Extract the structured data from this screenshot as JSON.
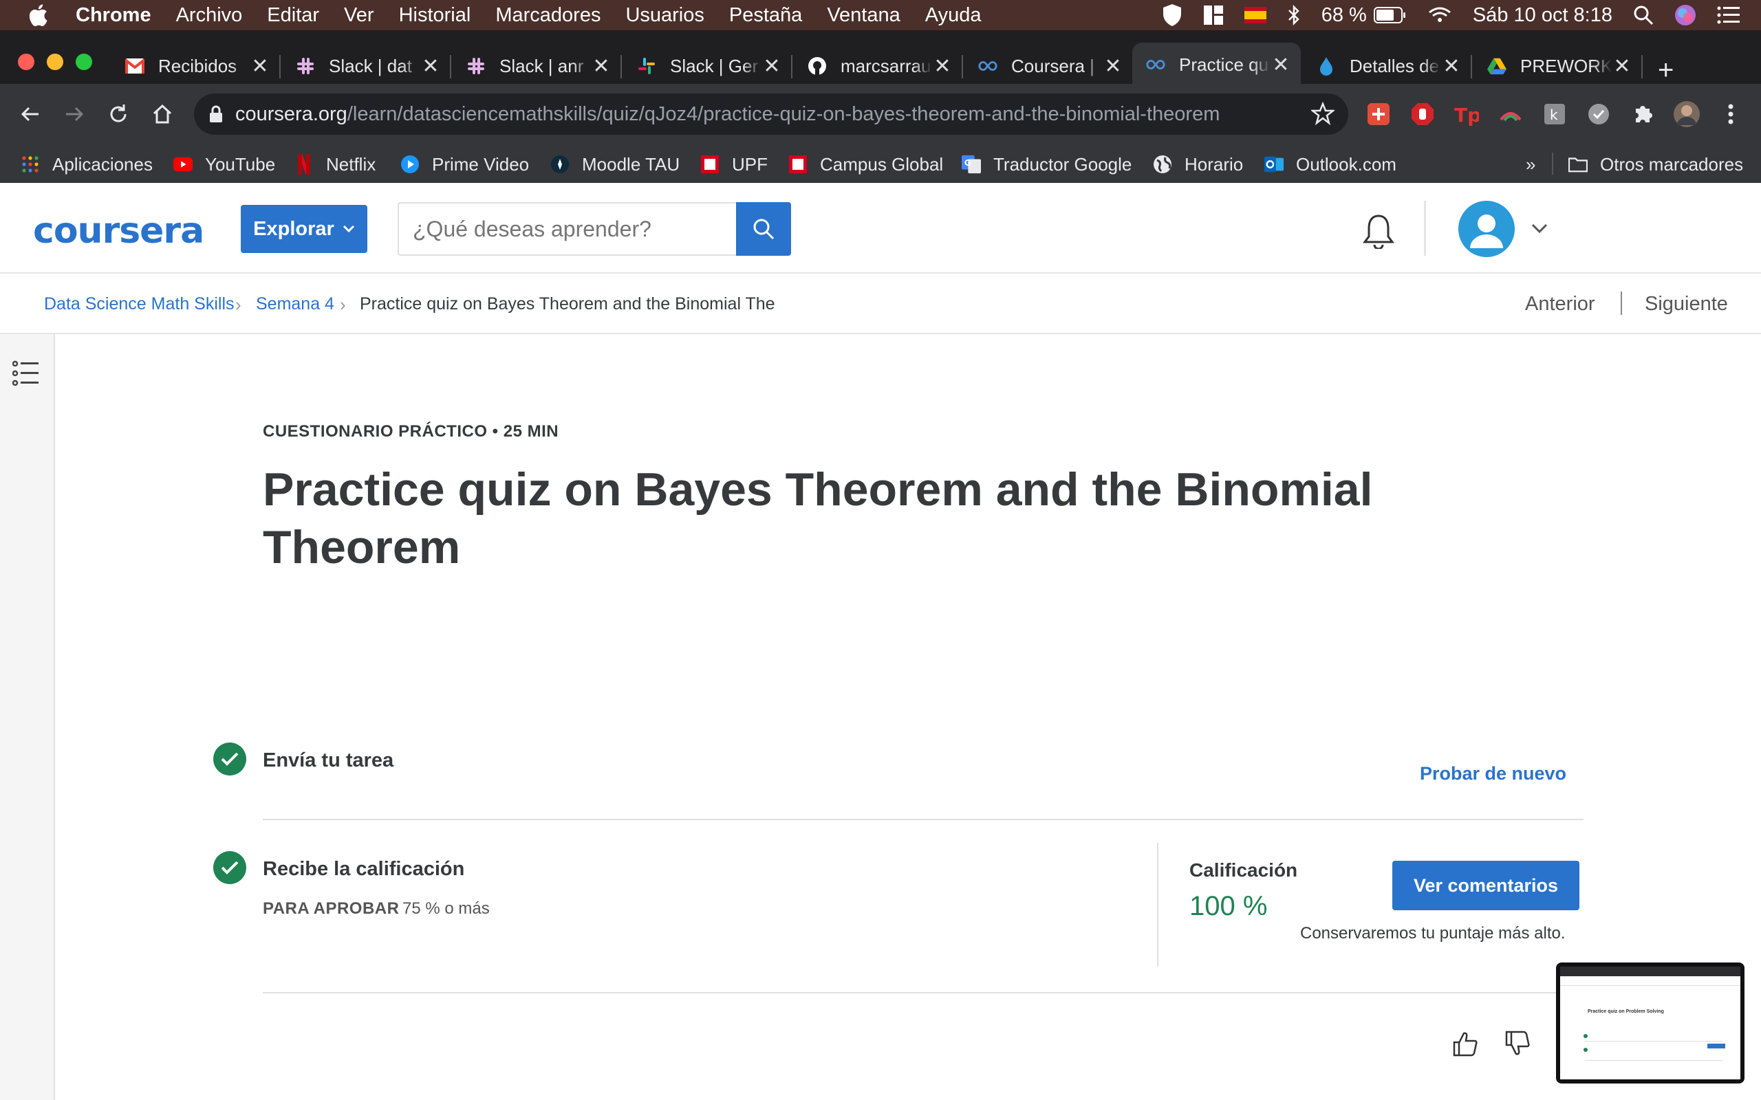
{
  "menubar": {
    "app": "Chrome",
    "items": [
      "Archivo",
      "Editar",
      "Ver",
      "Historial",
      "Marcadores",
      "Usuarios",
      "Pestaña",
      "Ventana",
      "Ayuda"
    ],
    "battery": "68 %",
    "datetime": "Sáb 10 oct  8:18"
  },
  "tabs": [
    {
      "title": "Recibidos",
      "icon": "gmail-icon",
      "active": false
    },
    {
      "title": "Slack | dat",
      "icon": "slack-icon",
      "active": false
    },
    {
      "title": "Slack | anr",
      "icon": "slack-icon",
      "active": false
    },
    {
      "title": "Slack | Ger",
      "icon": "slack-color-icon",
      "active": false
    },
    {
      "title": "marcsarrau",
      "icon": "github-icon",
      "active": false
    },
    {
      "title": "Coursera |",
      "icon": "coursera-icon",
      "active": false
    },
    {
      "title": "Practice qu",
      "icon": "coursera-icon",
      "active": true
    },
    {
      "title": "Detalles de",
      "icon": "drop-icon",
      "active": false
    },
    {
      "title": "PREWORK",
      "icon": "drive-icon",
      "active": false
    }
  ],
  "address": {
    "host": "coursera.org",
    "path": "/learn/datasciencemathskills/quiz/qJoz4/practice-quiz-on-bayes-theorem-and-the-binomial-theorem"
  },
  "bookmarks": {
    "items": [
      "Aplicaciones",
      "YouTube",
      "Netflix",
      "Prime Video",
      "Moodle TAU",
      "UPF",
      "Campus Global",
      "Traductor Google",
      "Horario",
      "Outlook.com"
    ],
    "more": "»",
    "other": "Otros marcadores"
  },
  "header": {
    "logo": "coursera",
    "explore": "Explorar",
    "search_placeholder": "¿Qué deseas aprender?"
  },
  "breadcrumb": {
    "course": "Data Science Math Skills",
    "week": "Semana 4",
    "current": "Practice quiz on Bayes Theorem and the Binomial The",
    "prev": "Anterior",
    "next": "Siguiente"
  },
  "quiz": {
    "kicker": "CUESTIONARIO PRÁCTICO • 25 MIN",
    "title": "Practice quiz on Bayes Theorem and the Binomial Theorem",
    "submit_step": "Envía tu tarea",
    "retry": "Probar de nuevo",
    "grade_step": "Recibe la calificación",
    "pass_label": "PARA APROBAR",
    "pass_value": "75 % o más",
    "grade_label": "Calificación",
    "grade_value": "100 %",
    "feedback_button": "Ver comentarios",
    "keep_note": "Conservaremos tu puntaje más alto."
  },
  "preview": {
    "title": "Practice quiz on Problem Solving"
  },
  "colors": {
    "brand": "#2a73cc",
    "success": "#1f8354"
  }
}
